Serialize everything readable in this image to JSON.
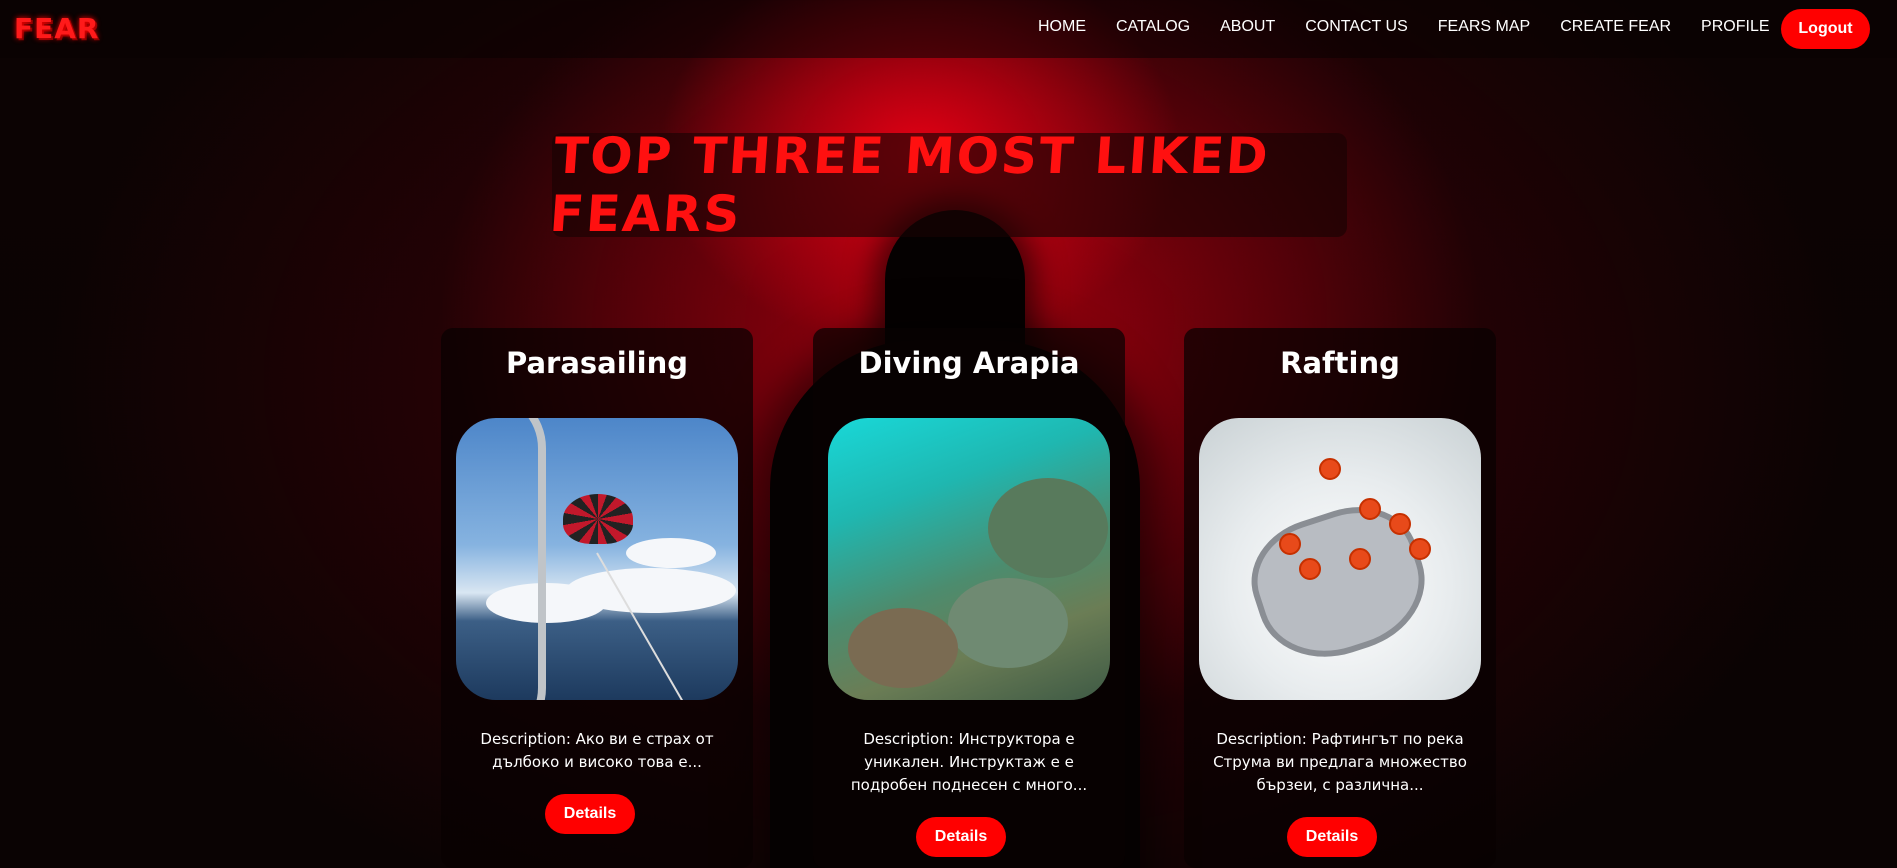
{
  "nav": {
    "logo": "FEAR",
    "links": [
      "HOME",
      "CATALOG",
      "ABOUT",
      "CONTACT US",
      "FEARS MAP",
      "CREATE FEAR",
      "PROFILE"
    ],
    "logout_label": "Logout"
  },
  "hero": {
    "title": "Top three most liked fears"
  },
  "cards": [
    {
      "title": "Parasailing",
      "description": "Description: Ако ви е страх от дълбоко и високо това е...",
      "button_label": "Details"
    },
    {
      "title": "Diving Arapia",
      "description": "Description: Инструктора е уникален. Инструктаж е е подробен поднесен с много...",
      "button_label": "Details"
    },
    {
      "title": "Rafting",
      "description": "Description: Рафтингът по река Струма ви предлага множество бързеи, с различна...",
      "button_label": "Details"
    }
  ],
  "colors": {
    "accent": "#ff0000",
    "title_red": "#ff1010",
    "background": "#0c0303"
  }
}
